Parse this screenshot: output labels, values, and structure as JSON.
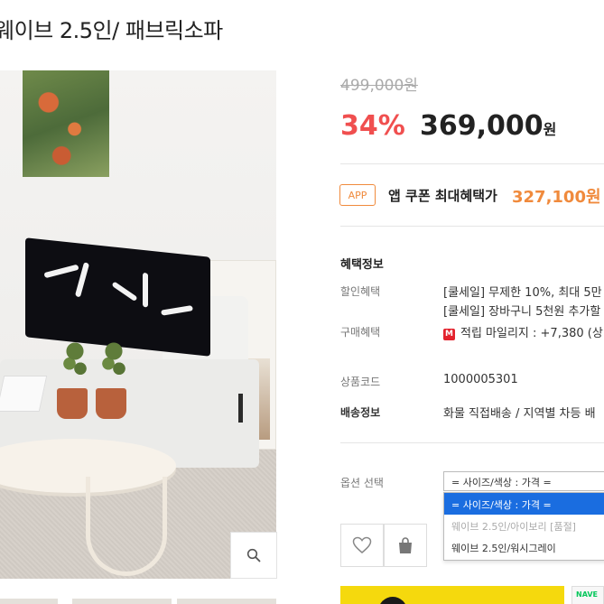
{
  "product": {
    "title": "웨이브 2.5인/ 패브릭소파",
    "original_price": "499,000원",
    "discount": "34%",
    "sale_price": "369,000",
    "currency": "원"
  },
  "coupon": {
    "badge": "APP",
    "label": "앱 쿠폰 최대혜택가",
    "price": "327,100원",
    "accent_color": "#f08a3c"
  },
  "benefits": {
    "section_title": "혜택정보",
    "discount_label": "할인혜택",
    "discount_line1": "[쿨세일] 무제한 10%, 최대 5만",
    "discount_line2": "[쿨세일] 장바구니 5천원 추가할",
    "purchase_label": "구매혜택",
    "mileage_badge": "M",
    "mileage_text": "적립 마일리지 : +7,380 (상"
  },
  "info": {
    "code_label": "상품코드",
    "code_value": "1000005301",
    "shipping_label": "배송정보",
    "shipping_value": "화물 직접배송 / 지역별 차등 배"
  },
  "options": {
    "label": "옵션 선택",
    "selected": "= 사이즈/색상 : 가격 =",
    "items": [
      "= 사이즈/색상 : 가격 =",
      "웨이브 2.5인/아이보리 [품절]",
      "웨이브 2.5인/워시그레이"
    ]
  },
  "actions": {
    "wishlist_icon": "heart-icon",
    "cart_icon": "shopping-bag-icon",
    "zoom_icon": "magnifier-icon"
  },
  "naver": {
    "label": "NAVE"
  },
  "colors": {
    "discount": "#f04f4f",
    "option_highlight": "#1a6de0",
    "buy_bar": "#f5d90d"
  }
}
